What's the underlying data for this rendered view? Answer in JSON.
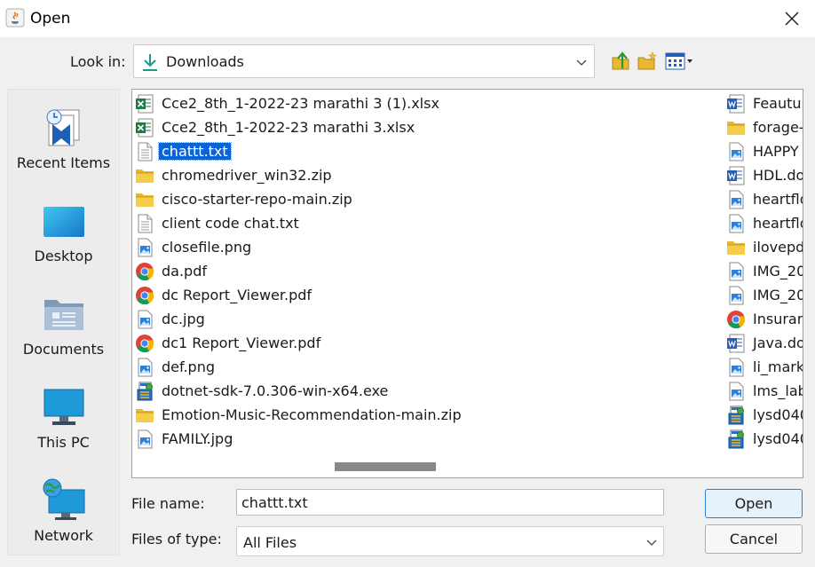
{
  "window": {
    "title": "Open"
  },
  "lookin": {
    "label": "Look in:",
    "value": "Downloads"
  },
  "sidebar": {
    "items": [
      {
        "label": "Recent Items"
      },
      {
        "label": "Desktop"
      },
      {
        "label": "Documents"
      },
      {
        "label": "This PC"
      },
      {
        "label": "Network"
      }
    ]
  },
  "files": {
    "column1": [
      {
        "name": "Cce2_8th_1-2022-23 marathi 3 (1).xlsx",
        "icon": "excel-icon"
      },
      {
        "name": "Cce2_8th_1-2022-23 marathi 3.xlsx",
        "icon": "excel-icon"
      },
      {
        "name": "chattt.txt",
        "icon": "text-file-icon",
        "selected": true
      },
      {
        "name": "chromedriver_win32.zip",
        "icon": "folder-zip-icon"
      },
      {
        "name": "cisco-starter-repo-main.zip",
        "icon": "folder-zip-icon"
      },
      {
        "name": "client code chat.txt",
        "icon": "text-file-icon"
      },
      {
        "name": "closefile.png",
        "icon": "image-file-icon"
      },
      {
        "name": "da.pdf",
        "icon": "chrome-icon"
      },
      {
        "name": "dc Report_Viewer.pdf",
        "icon": "chrome-icon"
      },
      {
        "name": "dc.jpg",
        "icon": "image-file-icon"
      },
      {
        "name": "dc1  Report_Viewer.pdf",
        "icon": "chrome-icon"
      },
      {
        "name": "def.png",
        "icon": "image-file-icon"
      },
      {
        "name": "dotnet-sdk-7.0.306-win-x64.exe",
        "icon": "installer-icon"
      },
      {
        "name": "Emotion-Music-Recommendation-main.zip",
        "icon": "folder-zip-icon"
      },
      {
        "name": "FAMILY.jpg",
        "icon": "image-file-icon"
      }
    ],
    "column2": [
      {
        "name": "Feautur",
        "icon": "word-icon"
      },
      {
        "name": "forage-",
        "icon": "folder-zip-icon"
      },
      {
        "name": "HAPPY",
        "icon": "image-file-icon"
      },
      {
        "name": "HDL.do",
        "icon": "word-icon"
      },
      {
        "name": "heartflo",
        "icon": "image-file-icon"
      },
      {
        "name": "heartflo",
        "icon": "image-file-icon"
      },
      {
        "name": "ilovepd",
        "icon": "folder-zip-icon"
      },
      {
        "name": "IMG_20",
        "icon": "image-file-icon"
      },
      {
        "name": "IMG_20",
        "icon": "image-file-icon"
      },
      {
        "name": "Insuran",
        "icon": "chrome-icon"
      },
      {
        "name": "Java.do",
        "icon": "word-icon"
      },
      {
        "name": "li_marke",
        "icon": "image-file-icon"
      },
      {
        "name": "lms_lab",
        "icon": "image-file-icon"
      },
      {
        "name": "lysd040",
        "icon": "installer-icon"
      },
      {
        "name": "lysd040",
        "icon": "installer-icon"
      }
    ]
  },
  "form": {
    "filename_label": "File name:",
    "filename_value": "chattt.txt",
    "filetype_label": "Files of type:",
    "filetype_value": "All Files"
  },
  "buttons": {
    "open": "Open",
    "cancel": "Cancel"
  }
}
